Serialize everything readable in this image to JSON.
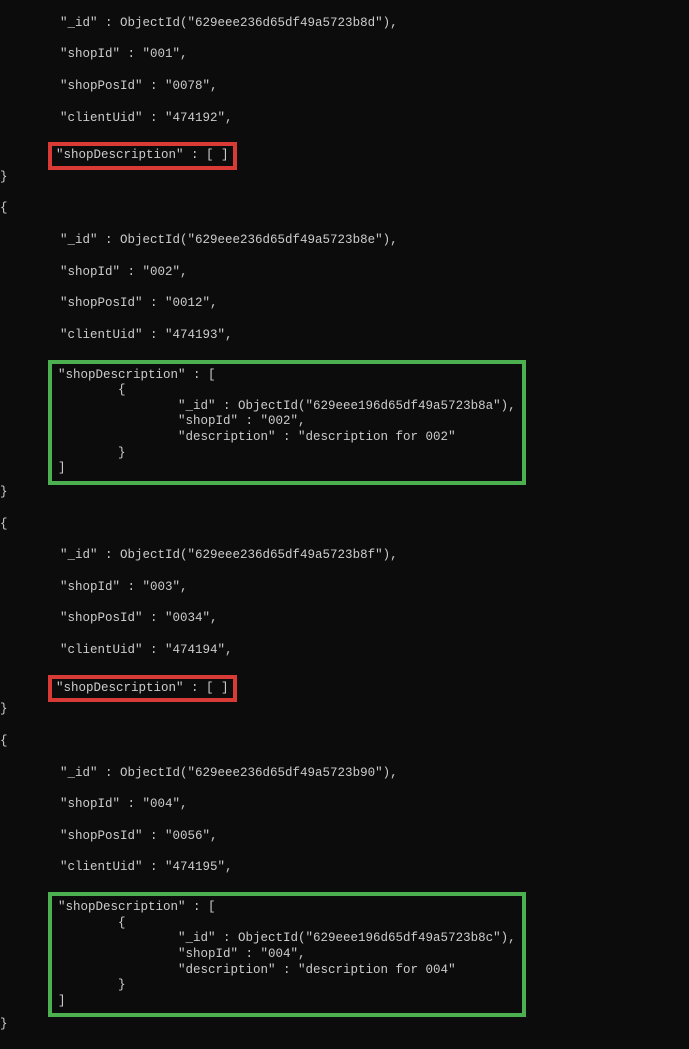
{
  "rec1": {
    "id": "\"_id\" : ObjectId(\"629eee236d65df49a5723b8d\"),",
    "shopId": "\"shopId\" : \"001\",",
    "shopPosId": "\"shopPosId\" : \"0078\",",
    "clientUid": "\"clientUid\" : \"474192\",",
    "shopDesc": "\"shopDescription\" : [ ]"
  },
  "rec2": {
    "id": "\"_id\" : ObjectId(\"629eee236d65df49a5723b8e\"),",
    "shopId": "\"shopId\" : \"002\",",
    "shopPosId": "\"shopPosId\" : \"0012\",",
    "clientUid": "\"clientUid\" : \"474193\",",
    "shopDesc": "\"shopDescription\" : [\n        {\n                \"_id\" : ObjectId(\"629eee196d65df49a5723b8a\"),\n                \"shopId\" : \"002\",\n                \"description\" : \"description for 002\"\n        }\n]"
  },
  "rec3": {
    "id": "\"_id\" : ObjectId(\"629eee236d65df49a5723b8f\"),",
    "shopId": "\"shopId\" : \"003\",",
    "shopPosId": "\"shopPosId\" : \"0034\",",
    "clientUid": "\"clientUid\" : \"474194\",",
    "shopDesc": "\"shopDescription\" : [ ]"
  },
  "rec4": {
    "id": "\"_id\" : ObjectId(\"629eee236d65df49a5723b90\"),",
    "shopId": "\"shopId\" : \"004\",",
    "shopPosId": "\"shopPosId\" : \"0056\",",
    "clientUid": "\"clientUid\" : \"474195\",",
    "shopDesc": "\"shopDescription\" : [\n        {\n                \"_id\" : ObjectId(\"629eee196d65df49a5723b8c\"),\n                \"shopId\" : \"004\",\n                \"description\" : \"description for 004\"\n        }\n]"
  },
  "braces": {
    "closeOpen": "}\n{",
    "close": "}",
    "open": "{",
    "closeTrail": "},"
  }
}
